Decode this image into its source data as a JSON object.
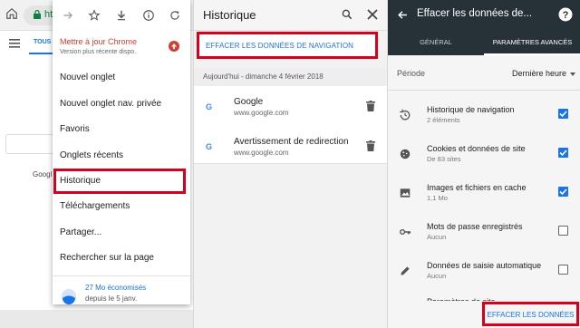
{
  "colors": {
    "accent": "#1a73e8",
    "update_red": "#d23f31",
    "highlight_red": "#d6001c",
    "dark_header": "#263238"
  },
  "panel1": {
    "url_text": "ht",
    "tab_label": "TOUS",
    "google_label": "Googl",
    "menu": {
      "icons": [
        "forward-icon",
        "star-icon",
        "download-icon",
        "info-icon",
        "refresh-icon"
      ],
      "update_title": "Mettre à jour Chrome",
      "update_subtitle": "Version plus récente dispo.",
      "items": [
        "Nouvel onglet",
        "Nouvel onglet nav. privée",
        "Favoris",
        "Onglets récents",
        "Historique",
        "Téléchargements",
        "Partager...",
        "Rechercher sur la page"
      ],
      "saved_title": "27 Mo économisés",
      "saved_subtitle": "depuis le 5 janv."
    }
  },
  "panel2": {
    "title": "Historique",
    "clear_link": "EFFACER LES DONNÉES DE NAVIGATION",
    "date_header": "Aujourd'hui - dimanche 4 février 2018",
    "entries": [
      {
        "title": "Google",
        "url": "www.google.com",
        "icon": "G"
      },
      {
        "title": "Avertissement de redirection",
        "url": "www.google.com",
        "icon": "G"
      }
    ]
  },
  "panel3": {
    "title": "Effacer les données de...",
    "tabs": [
      "GÉNÉRAL",
      "PARAMÈTRES AVANCÉS"
    ],
    "period_label": "Période",
    "period_value": "Dernière heure",
    "options": [
      {
        "title": "Historique de navigation",
        "subtitle": "2 éléments",
        "checked": true,
        "icon": "history-icon"
      },
      {
        "title": "Cookies et données de site",
        "subtitle": "De 83 sites",
        "checked": true,
        "icon": "cookie-icon"
      },
      {
        "title": "Images et fichiers en cache",
        "subtitle": "1,1 Mo",
        "checked": true,
        "icon": "image-icon"
      },
      {
        "title": "Mots de passe enregistrés",
        "subtitle": "Aucun",
        "checked": false,
        "icon": "key-icon"
      },
      {
        "title": "Données de saisie automatique",
        "subtitle": "Aucun",
        "checked": false,
        "icon": "pencil-icon"
      },
      {
        "title": "Paramètres de site",
        "subtitle": "",
        "checked": false,
        "icon": "settings-icon"
      }
    ],
    "clear_button": "EFFACER LES DONNÉES"
  }
}
